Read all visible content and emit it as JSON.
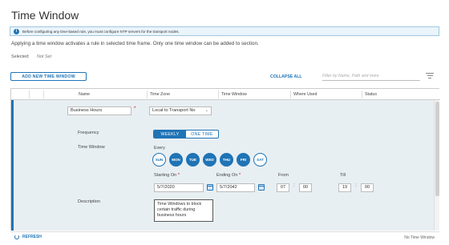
{
  "page": {
    "title": "Time Window",
    "info_banner": "Before configuring any time-based rule, you must configure NTP servers for the transport nodes.",
    "description": "Applying a time window activates a rule in selected time frame. Only one time window can be added to section.",
    "selected_label": "Selected:",
    "selected_value": "Not Set"
  },
  "toolbar": {
    "add_button": "ADD NEW TIME WINDOW",
    "collapse_all": "COLLAPSE ALL",
    "filter_placeholder": "Filter by Name, Path and more",
    "filter_icon": "filter-lines-icon"
  },
  "table": {
    "columns": [
      "Name",
      "Time Zone",
      "Time Window",
      "Where Used",
      "Status"
    ]
  },
  "row": {
    "name": "Business Hours",
    "name_required": "*",
    "time_zone": "Local to Transport No",
    "frequency_label": "Frequency",
    "frequency_options": [
      "WEEKLY",
      "ONE TIME"
    ],
    "frequency_selected": "WEEKLY",
    "time_window_label": "Time Window",
    "every_label": "Every",
    "days": [
      {
        "label": "SUN",
        "on": false
      },
      {
        "label": "MON",
        "on": true
      },
      {
        "label": "TUE",
        "on": true
      },
      {
        "label": "WED",
        "on": true
      },
      {
        "label": "THU",
        "on": true
      },
      {
        "label": "FRI",
        "on": true
      },
      {
        "label": "SAT",
        "on": false
      }
    ],
    "starting_on_label": "Starting On",
    "starting_on": "5/7/2020",
    "ending_on_label": "Ending On",
    "ending_on": "5/7/2042",
    "from_label": "From",
    "from_hour": "07",
    "from_minute": "00",
    "till_label": "Till",
    "till_hour": "19",
    "till_minute": "00",
    "description_label": "Description",
    "description": "Time Windows to block certain traffic during business hours"
  },
  "footer": {
    "refresh": "REFRESH",
    "status": "No Time Window"
  },
  "colors": {
    "accent": "#1f74b6",
    "row_bg": "#e8eff3"
  }
}
